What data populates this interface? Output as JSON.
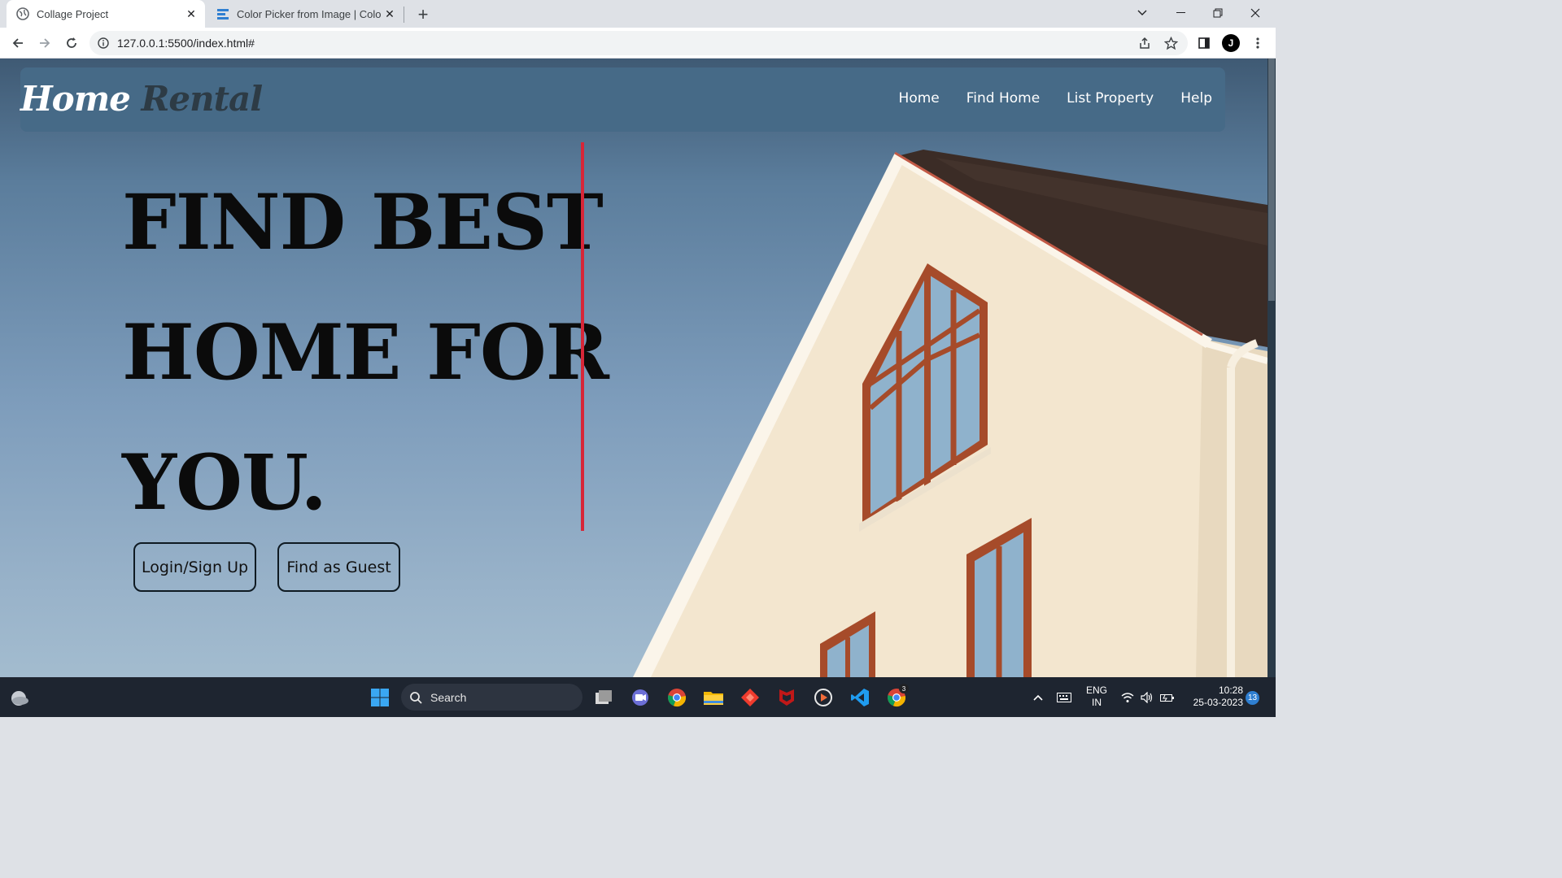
{
  "browser": {
    "tabs": [
      {
        "title": "Collage Project",
        "active": true
      },
      {
        "title": "Color Picker from Image | Color P",
        "active": false
      }
    ],
    "url": "127.0.0.1:5500/index.html#",
    "profile_initial": "J"
  },
  "page": {
    "logo": {
      "word1": "Home",
      "word2": "Rental"
    },
    "nav": [
      {
        "label": "Home"
      },
      {
        "label": "Find Home"
      },
      {
        "label": "List Property"
      },
      {
        "label": "Help"
      }
    ],
    "hero": {
      "line1": "FIND BEST",
      "line2": "HOME FOR",
      "line3": "YOU."
    },
    "buttons": {
      "login": "Login/Sign Up",
      "guest": "Find as Guest"
    },
    "colors": {
      "navbar": "#466a87",
      "accent_line": "#d72638",
      "house_wall": "#f3e6cf",
      "roof": "#3a2a24"
    }
  },
  "taskbar": {
    "search_label": "Search",
    "language": {
      "line1": "ENG",
      "line2": "IN"
    },
    "time": "10:28",
    "date": "25-03-2023",
    "notifications": "13",
    "chrome_badge": "3"
  }
}
